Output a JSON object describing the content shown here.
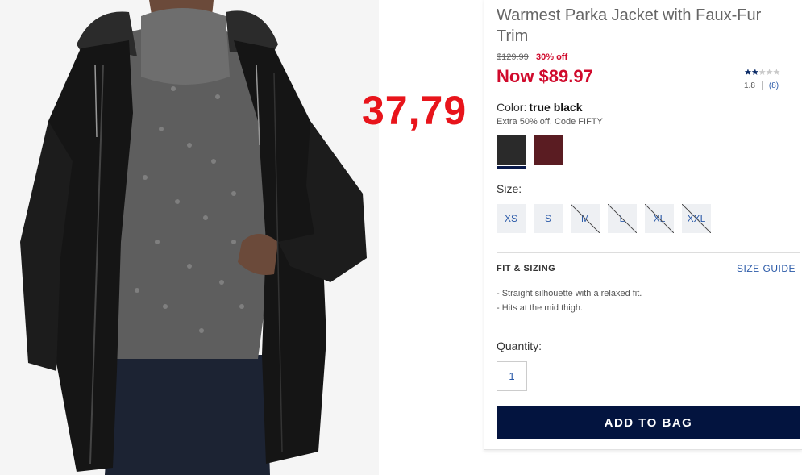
{
  "product": {
    "title": "Warmest Parka Jacket with Faux-Fur Trim",
    "was_price": "$129.99",
    "discount": "30% off",
    "now_price": "Now $89.97",
    "rating_value": "1.8",
    "rating_count": "(8)",
    "rating_stars": 2,
    "rating_max": 5
  },
  "annotation": {
    "handwritten_price": "37,79",
    "color": "#e8141b"
  },
  "color": {
    "label": "Color:",
    "value": "true black",
    "promo": "Extra 50% off. Code FIFTY",
    "swatches": [
      {
        "name": "true black",
        "hex": "#2a2a2a",
        "selected": true
      },
      {
        "name": "burgundy",
        "hex": "#5a1c22",
        "selected": false
      }
    ]
  },
  "size": {
    "label": "Size:",
    "options": [
      {
        "label": "XS",
        "available": true
      },
      {
        "label": "S",
        "available": true
      },
      {
        "label": "M",
        "available": false
      },
      {
        "label": "L",
        "available": false
      },
      {
        "label": "XL",
        "available": false
      },
      {
        "label": "XXL",
        "available": false
      }
    ]
  },
  "fit": {
    "title": "FIT & SIZING",
    "guide_link": "SIZE GUIDE",
    "bullets": [
      "- Straight silhouette with a relaxed fit.",
      "- Hits at the mid thigh."
    ]
  },
  "quantity": {
    "label": "Quantity:",
    "value": "1"
  },
  "cta": {
    "add_to_bag": "ADD TO BAG",
    "color": "#03143f"
  },
  "icons": {
    "star_filled": "star-icon",
    "star_empty": "star-outline-icon"
  }
}
